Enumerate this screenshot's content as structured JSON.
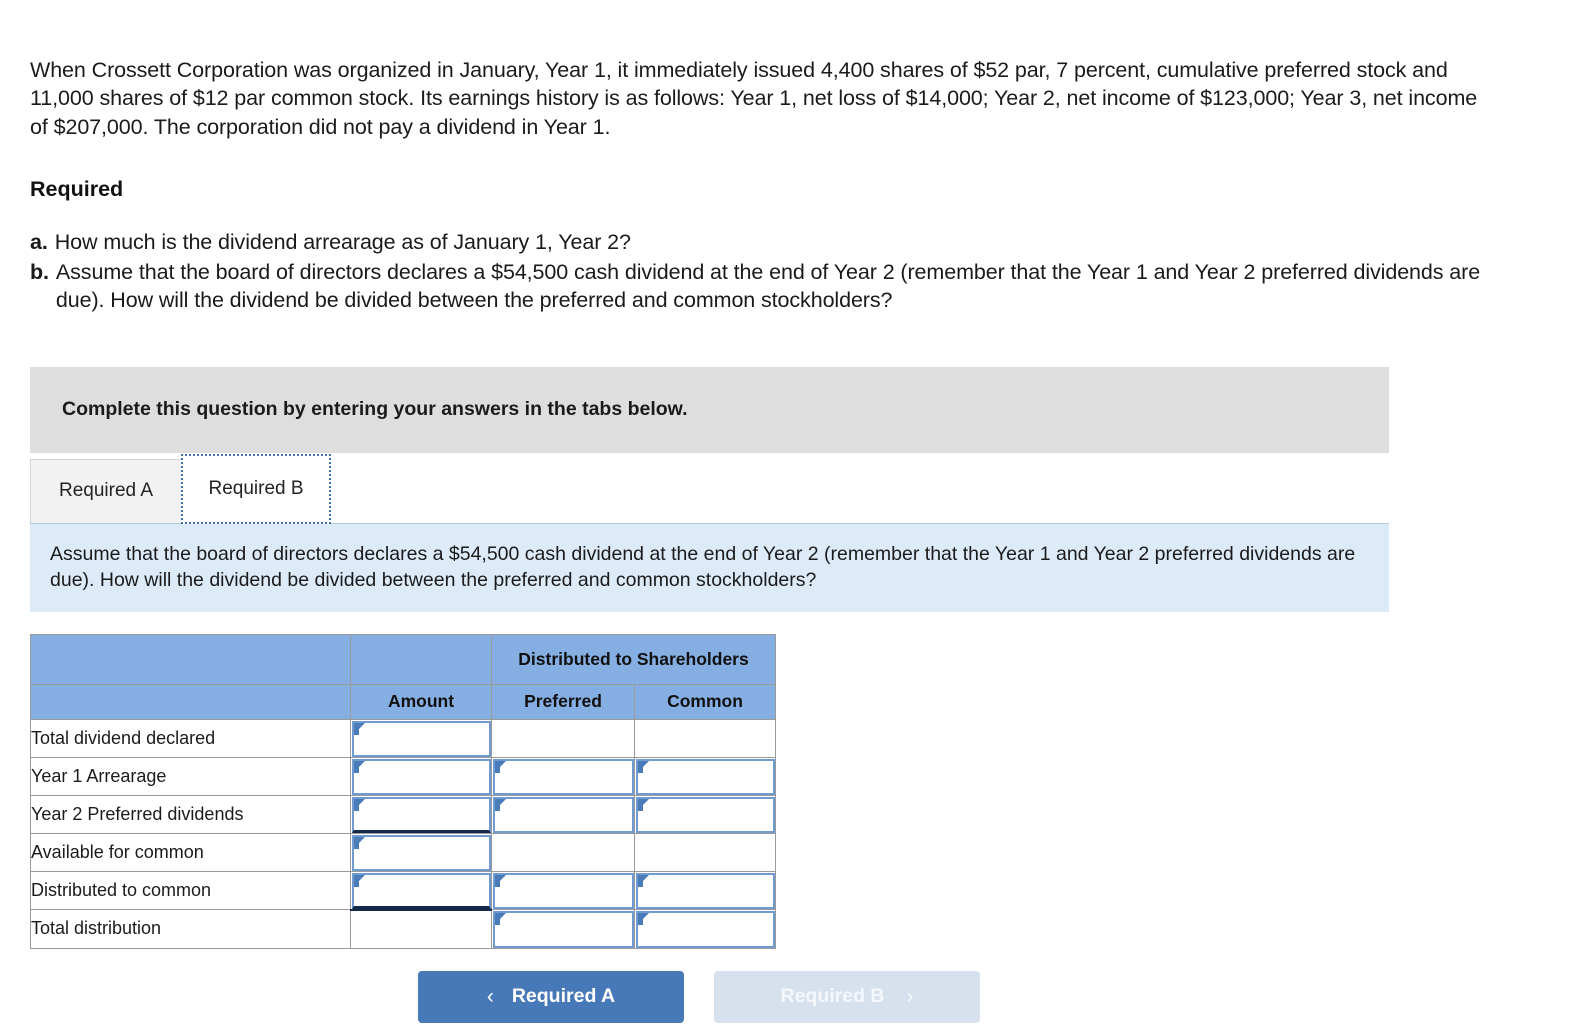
{
  "problem": {
    "statement": "When Crossett Corporation was organized in January, Year 1, it immediately issued 4,400 shares of $52 par, 7 percent, cumulative preferred stock and 11,000 shares of $12 par common stock. Its earnings history is as follows: Year 1, net loss of $14,000; Year 2, net income of $123,000; Year 3, net income of $207,000. The corporation did not pay a dividend in Year 1.",
    "required_heading": "Required",
    "requirements": [
      {
        "marker": "a.",
        "text": "How much is the dividend arrearage as of January 1, Year 2?"
      },
      {
        "marker": "b.",
        "text": "Assume that the board of directors declares a $54,500 cash dividend at the end of Year 2 (remember that the Year 1 and Year 2 preferred dividends are due). How will the dividend be divided between the preferred and common stockholders?"
      }
    ]
  },
  "banner": {
    "text": "Complete this question by entering your answers in the tabs below."
  },
  "tabs": [
    {
      "label": "Required A",
      "active": false
    },
    {
      "label": "Required B",
      "active": true
    }
  ],
  "info_box": {
    "text": "Assume that the board of directors declares a $54,500 cash dividend at the end of Year 2 (remember that the Year 1 and Year 2 preferred dividends are due). How will the dividend be divided between the preferred and common stockholders?"
  },
  "answer_table": {
    "group_header": "Distributed to Shareholders",
    "columns": [
      "",
      "Amount",
      "Preferred",
      "Common"
    ],
    "rows": [
      {
        "label": "Total dividend declared",
        "amount": "",
        "preferred": "",
        "common": ""
      },
      {
        "label": "Year 1 Arrearage",
        "amount": "",
        "preferred": "",
        "common": ""
      },
      {
        "label": "Year 2 Preferred dividends",
        "amount": "",
        "preferred": "",
        "common": ""
      },
      {
        "label": "Available for common",
        "amount": "",
        "preferred": "",
        "common": ""
      },
      {
        "label": "Distributed to common",
        "amount": "",
        "preferred": "",
        "common": ""
      },
      {
        "label": "Total distribution",
        "amount": "",
        "preferred": "",
        "common": ""
      }
    ]
  },
  "nav": {
    "prev_label": "Required A",
    "next_label": "Required B",
    "prev_chevron": "‹",
    "next_chevron": "›"
  },
  "colors": {
    "banner_gray": "#dedede",
    "info_blue": "#ddeaf8",
    "table_header_blue": "#85aee2",
    "input_border_blue": "#6f9bd1",
    "button_blue": "#4779b8",
    "button_disabled": "#d7e1ed",
    "tab_focus_blue": "#3e72b0"
  }
}
